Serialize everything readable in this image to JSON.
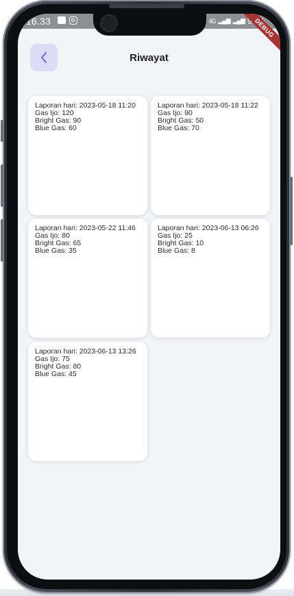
{
  "status_bar": {
    "time": "16.33",
    "right_text": "96%",
    "network": "4G"
  },
  "debug_banner": "DEBUG",
  "app_bar": {
    "title": "Riwayat",
    "back_icon": "chevron-left-icon"
  },
  "reports": [
    {
      "date": "Laporan hari: 2023-05-18 11:20",
      "gas_ijo": "Gas Ijo: 120",
      "bright_gas": "Bright Gas: 90",
      "blue_gas": "Blue Gas: 60"
    },
    {
      "date": "Laporan hari: 2023-05-18 11:22",
      "gas_ijo": "Gas Ijo: 90",
      "bright_gas": "Bright Gas: 50",
      "blue_gas": "Blue Gas: 70"
    },
    {
      "date": "Laporan hari: 2023-05-22 11:46",
      "gas_ijo": "Gas Ijo: 80",
      "bright_gas": "Bright Gas: 65",
      "blue_gas": "Blue Gas: 35"
    },
    {
      "date": "Laporan hari: 2023-06-13 06:26",
      "gas_ijo": "Gas Ijo: 25",
      "bright_gas": "Bright Gas: 10",
      "blue_gas": "Blue Gas: 8"
    },
    {
      "date": "Laporan hari: 2023-06-13 13:26",
      "gas_ijo": "Gas Ijo: 75",
      "bright_gas": "Bright Gas: 80",
      "blue_gas": "Blue Gas: 45"
    }
  ],
  "colors": {
    "accent": "#6c63d9",
    "back_bg": "#dcdcf7",
    "screen_bg": "#f3f4f8",
    "debug": "#a83333"
  }
}
